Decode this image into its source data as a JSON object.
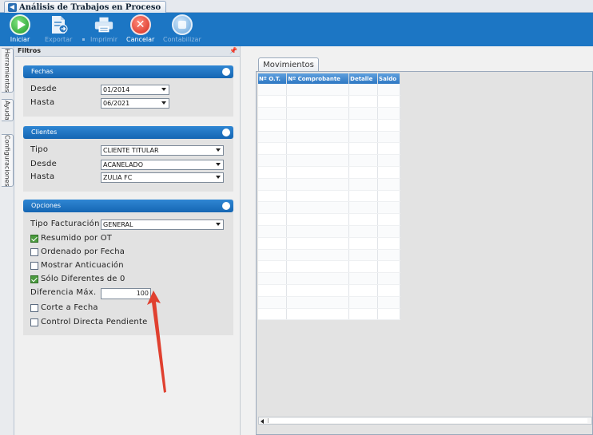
{
  "window": {
    "title": "Análisis de Trabajos en Proceso"
  },
  "toolbar": {
    "iniciar": "Iniciar",
    "exportar": "Exportar",
    "imprimir": "Imprimir",
    "cancelar": "Cancelar",
    "contabilizar": "Contabilizar"
  },
  "side_tabs": [
    "Herramientas",
    "Ayuda",
    "Configuraciones"
  ],
  "filtros": {
    "title": "Filtros",
    "fechas": {
      "header": "Fechas",
      "desde_label": "Desde",
      "desde_value": "01/2014",
      "hasta_label": "Hasta",
      "hasta_value": "06/2021"
    },
    "clientes": {
      "header": "Clientes",
      "tipo_label": "Tipo",
      "tipo_value": "CLIENTE TITULAR",
      "desde_label": "Desde",
      "desde_value": "ACANELADO",
      "hasta_label": "Hasta",
      "hasta_value": "ZULIA FC"
    },
    "opciones": {
      "header": "Opciones",
      "tipo_facturacion_label": "Tipo Facturación",
      "tipo_facturacion_value": "GENERAL",
      "resumido_label": "Resumido por OT",
      "ordenado_label": "Ordenado por Fecha",
      "anticuacion_label": "Mostrar Anticuación",
      "solo_diferentes_label": "Sólo Diferentes de 0",
      "diferencia_label": "Diferencia Máx.",
      "diferencia_value": "100",
      "corte_label": "Corte a Fecha",
      "control_label": "Control Directa Pendiente"
    }
  },
  "movimientos": {
    "tab": "Movimientos",
    "columns": [
      "Nº O.T.",
      "Nº Comprobante",
      "Detalle",
      "Saldo"
    ]
  },
  "colors": {
    "toolbar": "#1c76c4",
    "group_header": "#1f74c2",
    "annotation_arrow": "#e0402f"
  }
}
